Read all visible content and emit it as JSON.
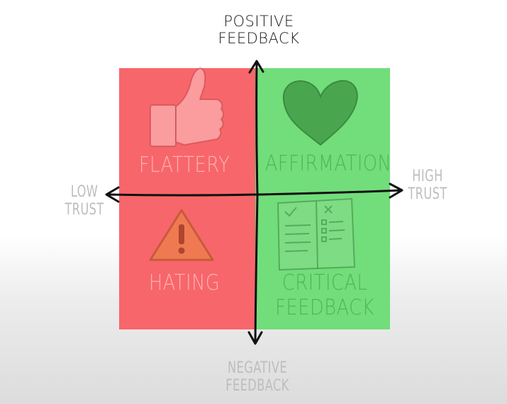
{
  "axis": {
    "top": [
      "POSITIVE",
      "FEEDBACK"
    ],
    "bottom": [
      "NEGATIVE",
      "FEEDBACK"
    ],
    "left": [
      "LOW",
      "TRUST"
    ],
    "right": [
      "HIGH",
      "TRUST"
    ]
  },
  "quadrants": {
    "top_left": {
      "label": "FLATTERY",
      "icon": "thumbs-up-icon",
      "color": "#f86a6e"
    },
    "top_right": {
      "label": "AFFIRMATION",
      "icon": "heart-icon",
      "color": "#74de7c"
    },
    "bottom_left": {
      "label": "HATING",
      "icon": "warning-icon",
      "color": "#f86a6e"
    },
    "bottom_right": {
      "label_lines": [
        "CRITICAL",
        "FEEDBACK"
      ],
      "icon": "checklist-icon",
      "color": "#74de7c"
    }
  }
}
